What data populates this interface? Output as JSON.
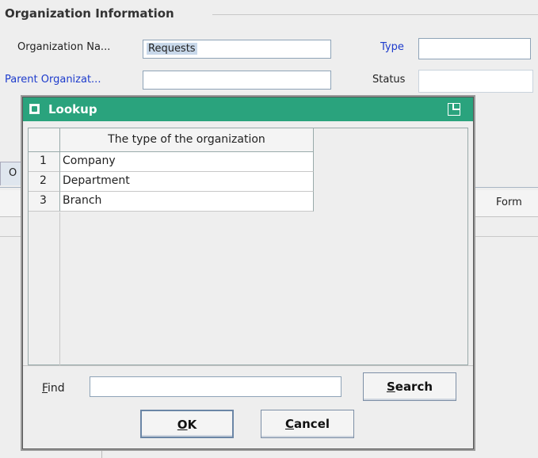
{
  "form": {
    "group_title": "Organization Information",
    "org_name_label": "Organization Na...",
    "org_name_value": "Requests",
    "type_label": "Type",
    "type_value": "",
    "parent_org_label": "Parent Organizat...",
    "parent_org_value": "",
    "status_label": "Status",
    "status_value": "",
    "tab_label": "O",
    "table_header_form": "Form"
  },
  "dialog": {
    "title": "Lookup",
    "column_header": "The type of the organization",
    "rows": [
      {
        "num": "1",
        "value": "Company"
      },
      {
        "num": "2",
        "value": "Department"
      },
      {
        "num": "3",
        "value": "Branch"
      }
    ],
    "find_label_mnemonic": "F",
    "find_label_rest": "ind",
    "find_value": "",
    "search_mnemonic": "S",
    "search_rest": "earch",
    "ok_mnemonic": "O",
    "ok_rest": "K",
    "cancel_mnemonic": "C",
    "cancel_rest": "ancel"
  },
  "colors": {
    "titlebar": "#2aa37d",
    "link_label": "#1d3bcc"
  }
}
